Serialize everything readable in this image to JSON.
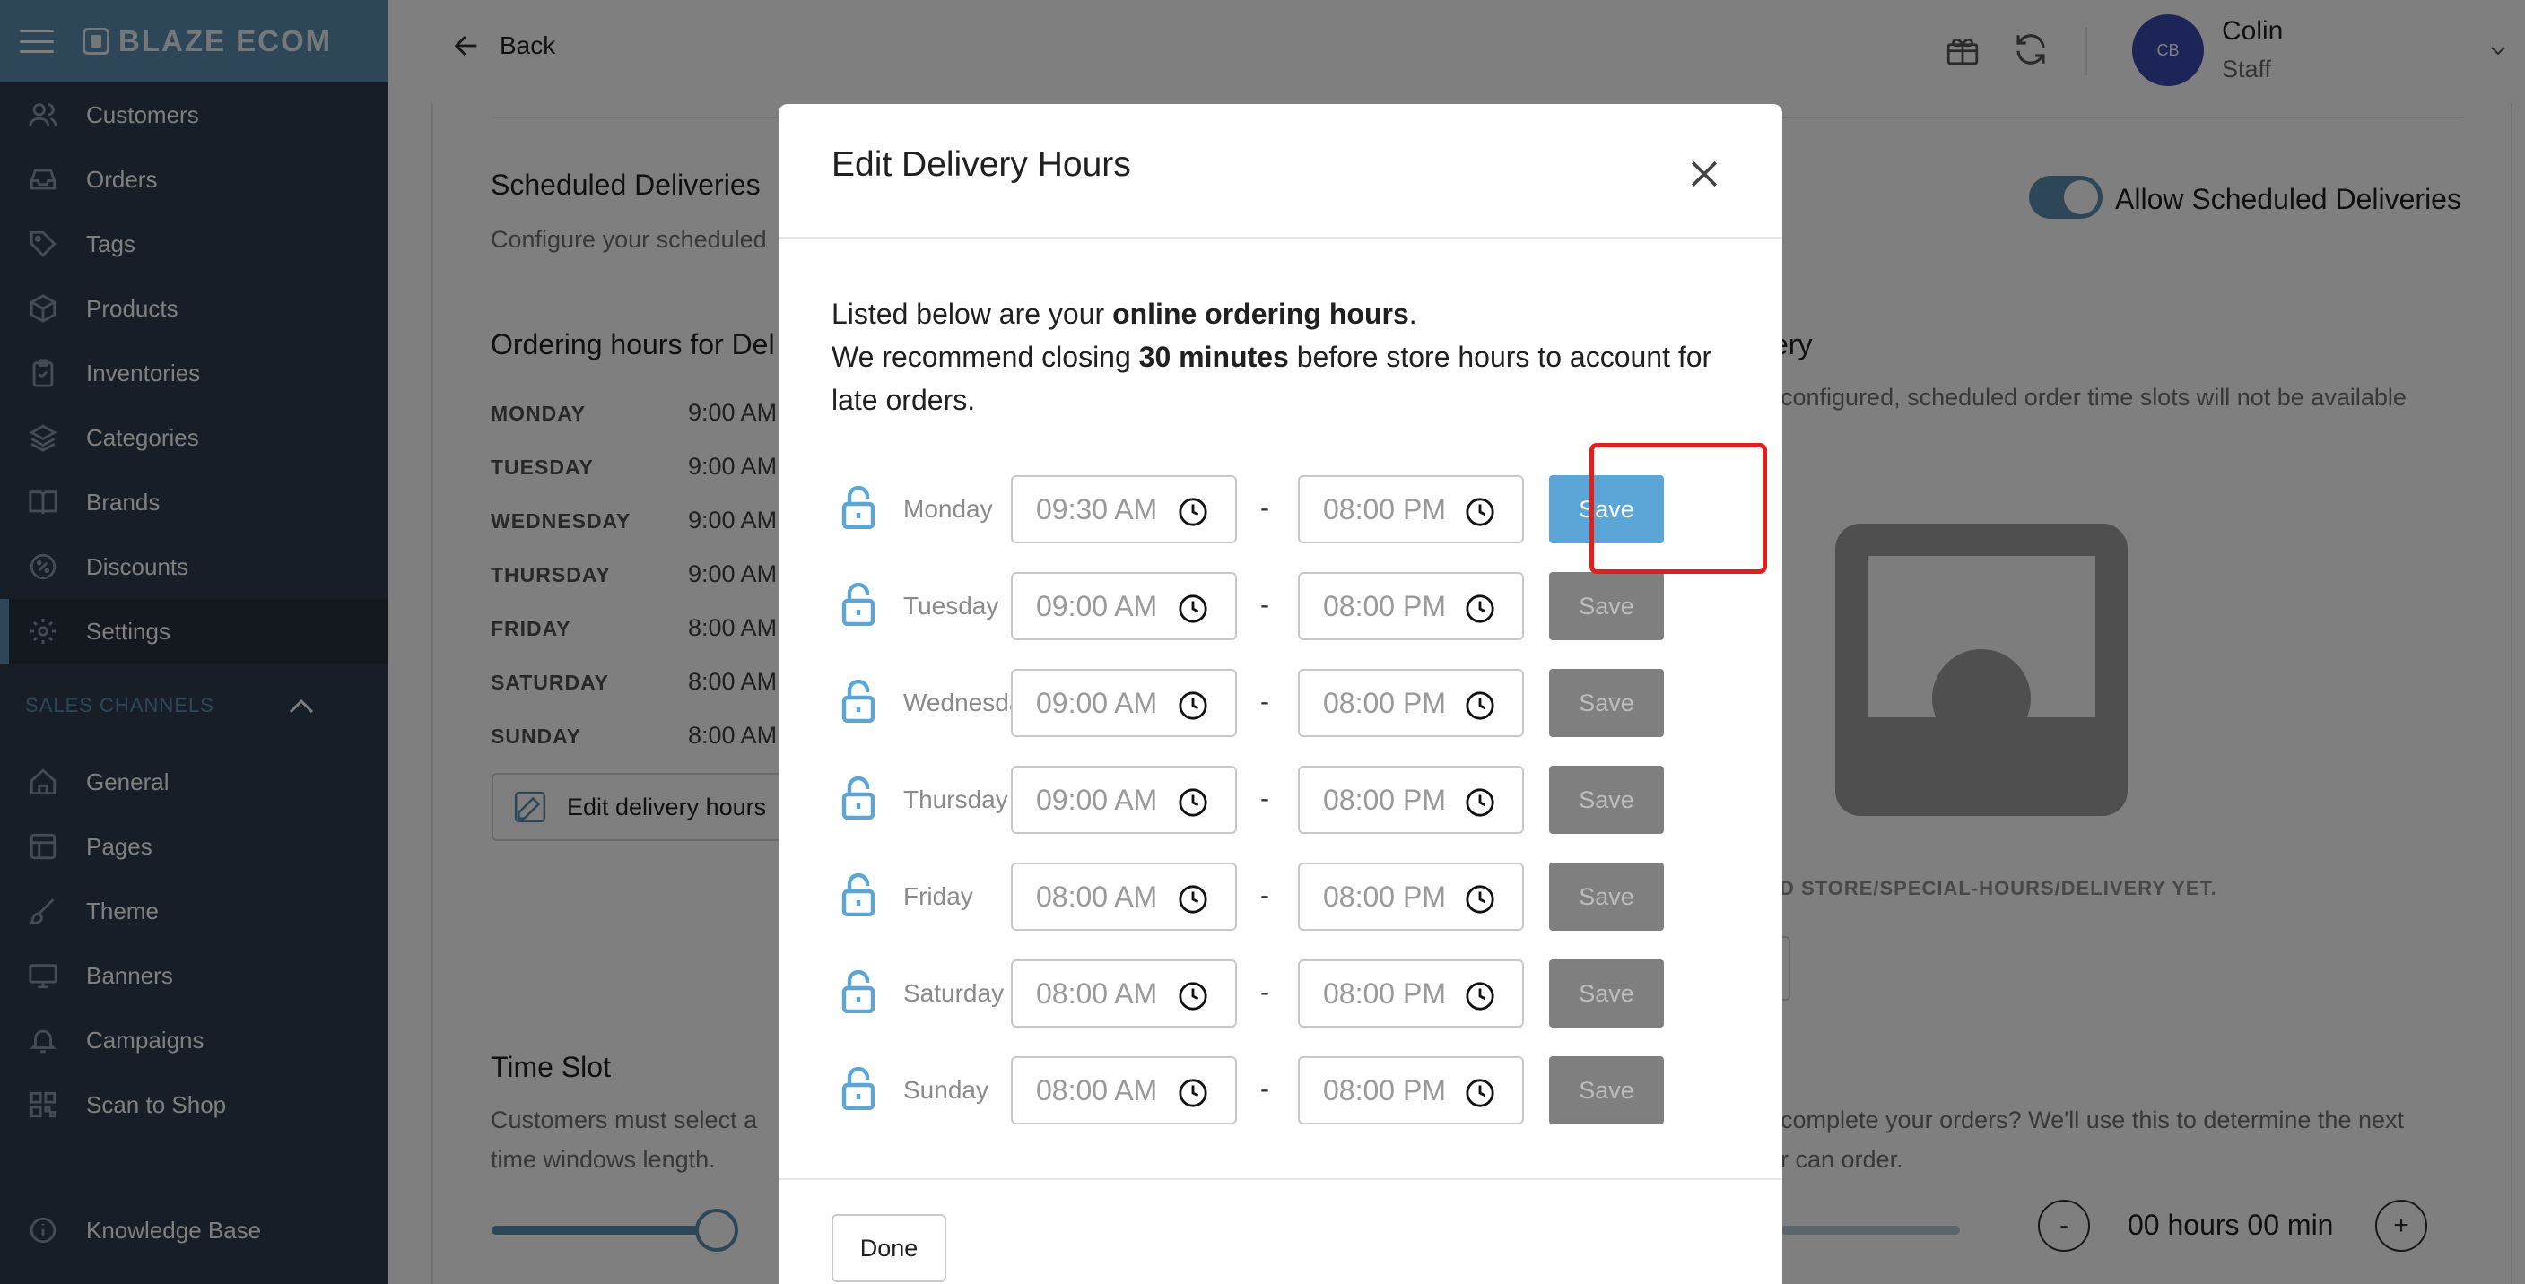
{
  "app": {
    "brand": "BLAZE ECOM"
  },
  "sidebar": {
    "items": [
      {
        "label": "Customers",
        "icon": "users-icon"
      },
      {
        "label": "Orders",
        "icon": "inbox-icon"
      },
      {
        "label": "Tags",
        "icon": "tag-icon"
      },
      {
        "label": "Products",
        "icon": "box-icon"
      },
      {
        "label": "Inventories",
        "icon": "clipboard-icon"
      },
      {
        "label": "Categories",
        "icon": "layers-icon"
      },
      {
        "label": "Brands",
        "icon": "book-icon"
      },
      {
        "label": "Discounts",
        "icon": "percent-badge-icon"
      },
      {
        "label": "Settings",
        "icon": "gear-icon",
        "active": true
      }
    ],
    "section_label": "SALES CHANNELS",
    "channel_items": [
      {
        "label": "General",
        "icon": "home-icon"
      },
      {
        "label": "Pages",
        "icon": "layout-icon"
      },
      {
        "label": "Theme",
        "icon": "brush-icon"
      },
      {
        "label": "Banners",
        "icon": "monitor-icon"
      },
      {
        "label": "Campaigns",
        "icon": "bell-icon"
      },
      {
        "label": "Scan to Shop",
        "icon": "qr-icon"
      }
    ],
    "footer_item": {
      "label": "Knowledge Base",
      "icon": "info-icon"
    }
  },
  "header": {
    "back_label": "Back",
    "user_initials": "CB",
    "user_name": "Colin",
    "user_role": "Staff"
  },
  "background": {
    "scheduled_title": "Scheduled Deliveries",
    "scheduled_sub": "Configure your scheduled",
    "ordering_title": "Ordering hours for Del",
    "hours": [
      {
        "day": "MONDAY",
        "time": "9:00 AM"
      },
      {
        "day": "TUESDAY",
        "time": "9:00 AM"
      },
      {
        "day": "WEDNESDAY",
        "time": "9:00 AM"
      },
      {
        "day": "THURSDAY",
        "time": "9:00 AM"
      },
      {
        "day": "FRIDAY",
        "time": "8:00 AM"
      },
      {
        "day": "SATURDAY",
        "time": "8:00 AM"
      },
      {
        "day": "SUNDAY",
        "time": "8:00 AM"
      }
    ],
    "edit_button": "Edit delivery hours",
    "toggle_label": "Allow Scheduled Deliveries",
    "toggle_on": true,
    "right_heading": "very",
    "right_sub": "configured, scheduled order time slots will not be available",
    "empty_text": "D STORE/SPECIAL-HOURS/DELIVERY YET.",
    "time_slot_title": "Time Slot",
    "time_slot_sub_1": "Customers must select a",
    "time_slot_sub_2": "time windows length.",
    "right_sub2_1": "complete your orders? We'll use this to determine the next",
    "right_sub2_2": "r can order.",
    "duration_value": "00 hours 00 min",
    "minus": "-",
    "plus": "+"
  },
  "modal": {
    "title": "Edit Delivery Hours",
    "intro_1": "Listed below are your ",
    "intro_bold_1": "online ordering hours",
    "intro_2": ".",
    "intro_3": "We recommend closing ",
    "intro_bold_2": "30 minutes",
    "intro_4": " before store hours to account for late orders.",
    "dash": "-",
    "save_label": "Save",
    "done_label": "Done",
    "rows": [
      {
        "day": "Monday",
        "start": "09:30 AM",
        "end": "08:00 PM",
        "save_active": true
      },
      {
        "day": "Tuesday",
        "start": "09:00 AM",
        "end": "08:00 PM",
        "save_active": false
      },
      {
        "day": "Wednesday",
        "start": "09:00 AM",
        "end": "08:00 PM",
        "save_active": false
      },
      {
        "day": "Thursday",
        "start": "09:00 AM",
        "end": "08:00 PM",
        "save_active": false
      },
      {
        "day": "Friday",
        "start": "08:00 AM",
        "end": "08:00 PM",
        "save_active": false
      },
      {
        "day": "Saturday",
        "start": "08:00 AM",
        "end": "08:00 PM",
        "save_active": false
      },
      {
        "day": "Sunday",
        "start": "08:00 AM",
        "end": "08:00 PM",
        "save_active": false
      }
    ]
  },
  "colors": {
    "sidebar_bg": "#2f3d4f",
    "accent": "#5d8fb0",
    "save_active": "#5ba6d6",
    "save_disabled": "#7f7f7f",
    "highlight": "#e0201c"
  }
}
